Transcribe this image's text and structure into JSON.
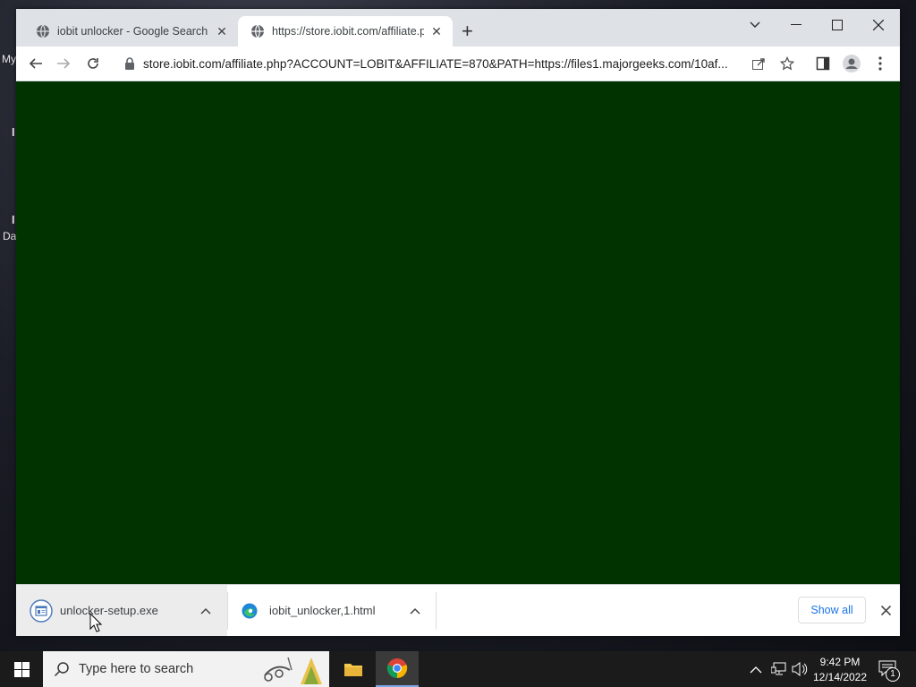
{
  "desktop": {
    "frag1": "My",
    "frag2": "I",
    "frag3": "I",
    "frag4": "Da"
  },
  "browser": {
    "tabs": [
      {
        "title": "iobit unlocker - Google Search",
        "active": false
      },
      {
        "title": "https://store.iobit.com/affiliate.p",
        "active": true
      }
    ],
    "url": "store.iobit.com/affiliate.php?ACCOUNT=LOBIT&AFFILIATE=870&PATH=https://files1.majorgeeks.com/10af...",
    "page_bg": "#003300"
  },
  "downloads": {
    "items": [
      {
        "name": "unlocker-setup.exe",
        "icon": "installer-file-icon"
      },
      {
        "name": "iobit_unlocker,1.html",
        "icon": "edge-icon"
      }
    ],
    "show_all": "Show all"
  },
  "taskbar": {
    "search_placeholder": "Type here to search",
    "time": "9:42 PM",
    "date": "12/14/2022",
    "notifications_count": "1"
  }
}
